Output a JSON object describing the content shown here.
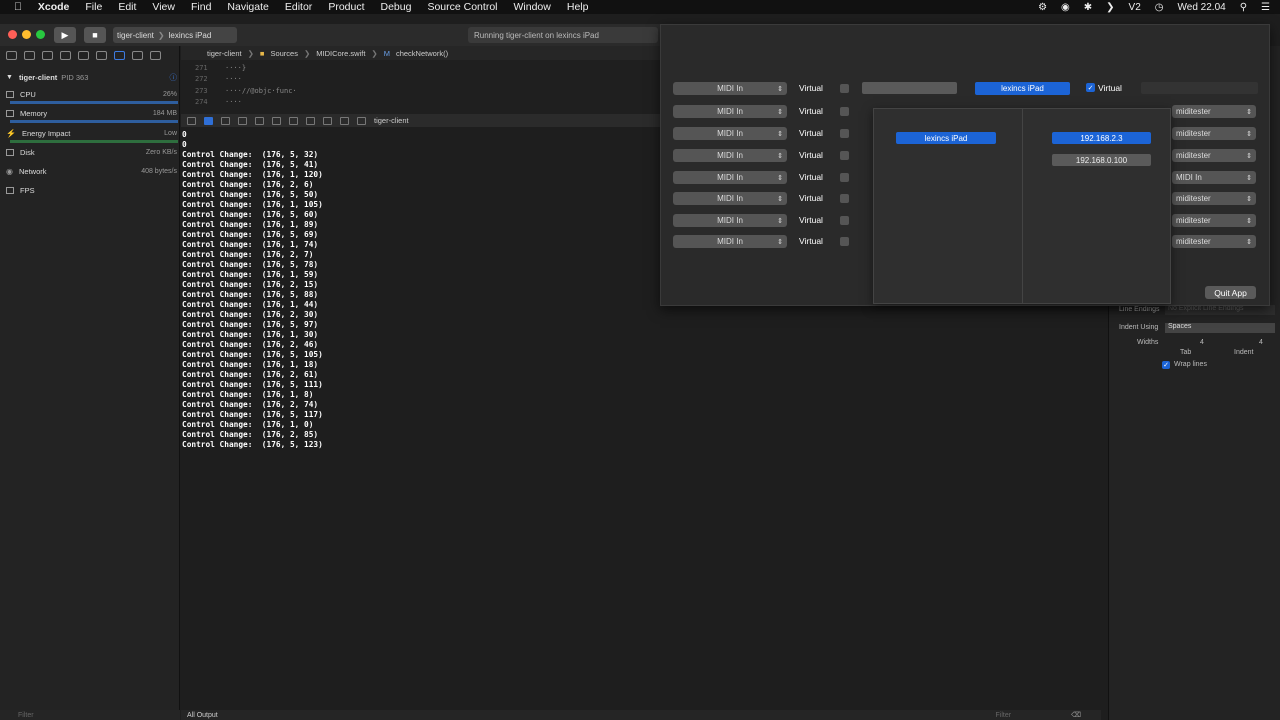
{
  "menubar": {
    "apple": "",
    "app": "Xcode",
    "items": [
      "File",
      "Edit",
      "View",
      "Find",
      "Navigate",
      "Editor",
      "Product",
      "Debug",
      "Source Control",
      "Window",
      "Help"
    ],
    "clock": "Wed 22.04"
  },
  "toolbar": {
    "scheme": "tiger-client",
    "device": "lexincs iPad",
    "status": "Running tiger-client on lexincs iPad"
  },
  "jumpbar": {
    "crumbs": [
      "tiger-client",
      "Sources",
      "MIDICore.swift",
      "checkNetwork()"
    ]
  },
  "code": {
    "lines": [
      {
        "n": "271",
        "t": "····}"
      },
      {
        "n": "272",
        "t": "····"
      },
      {
        "n": "273",
        "t": "····//@objc·func·"
      },
      {
        "n": "274",
        "t": "····"
      }
    ]
  },
  "debug": {
    "process": "tiger-client"
  },
  "navigator": {
    "process": "tiger-client",
    "pid": "PID 363",
    "gauges": [
      {
        "label": "CPU",
        "value": "26%"
      },
      {
        "label": "Memory",
        "value": "184 MB"
      },
      {
        "label": "Energy Impact",
        "value": "Low"
      },
      {
        "label": "Disk",
        "value": "Zero KB/s"
      },
      {
        "label": "Network",
        "value": "408 bytes/s"
      },
      {
        "label": "FPS",
        "value": ""
      }
    ],
    "filter_placeholder": "Filter"
  },
  "console": {
    "lines": [
      "0",
      "0",
      "Control Change:  (176, 5, 32)",
      "Control Change:  (176, 5, 41)",
      "Control Change:  (176, 1, 120)",
      "Control Change:  (176, 2, 6)",
      "Control Change:  (176, 5, 50)",
      "Control Change:  (176, 1, 105)",
      "Control Change:  (176, 5, 60)",
      "Control Change:  (176, 1, 89)",
      "Control Change:  (176, 5, 69)",
      "Control Change:  (176, 1, 74)",
      "Control Change:  (176, 2, 7)",
      "Control Change:  (176, 5, 78)",
      "Control Change:  (176, 1, 59)",
      "Control Change:  (176, 2, 15)",
      "Control Change:  (176, 5, 88)",
      "Control Change:  (176, 1, 44)",
      "Control Change:  (176, 2, 30)",
      "Control Change:  (176, 5, 97)",
      "Control Change:  (176, 1, 30)",
      "Control Change:  (176, 2, 46)",
      "Control Change:  (176, 5, 105)",
      "Control Change:  (176, 1, 18)",
      "Control Change:  (176, 2, 61)",
      "Control Change:  (176, 5, 111)",
      "Control Change:  (176, 1, 8)",
      "Control Change:  (176, 2, 74)",
      "Control Change:  (176, 5, 117)",
      "Control Change:  (176, 1, 0)",
      "Control Change:  (176, 2, 85)",
      "Control Change:  (176, 5, 123)"
    ],
    "output_selector": "All Output",
    "filter_placeholder": "Filter"
  },
  "inspector": {
    "line_endings_label": "Line Endings",
    "line_endings_value": "No Explicit Line Endings",
    "indent_using_label": "Indent Using",
    "indent_using_value": "Spaces",
    "widths_label": "Widths",
    "tab_value": "4",
    "indent_value": "4",
    "tab_label": "Tab",
    "indent_label": "Indent",
    "wrap_lines": "Wrap lines"
  },
  "app": {
    "rows": [
      {
        "input": "MIDI In",
        "virtual": "Virtual",
        "right": ""
      },
      {
        "input": "MIDI In",
        "virtual": "Virtual",
        "right": "miditester"
      },
      {
        "input": "MIDI In",
        "virtual": "Virtual",
        "right": "miditester"
      },
      {
        "input": "MIDI In",
        "virtual": "Virtual",
        "right": "miditester"
      },
      {
        "input": "MIDI In",
        "virtual": "Virtual",
        "right": "MIDI In"
      },
      {
        "input": "MIDI In",
        "virtual": "Virtual",
        "right": "miditester"
      },
      {
        "input": "MIDI In",
        "virtual": "Virtual",
        "right": "miditester"
      },
      {
        "input": "MIDI In",
        "virtual": "Virtual",
        "right": "miditester"
      }
    ],
    "device_selected": "lexincs iPad",
    "top_virtual": "Virtual",
    "popover": {
      "device": "lexincs iPad",
      "ip_selected": "192.168.2.3",
      "ip_other": "192.168.0.100"
    },
    "quit": "Quit App"
  }
}
